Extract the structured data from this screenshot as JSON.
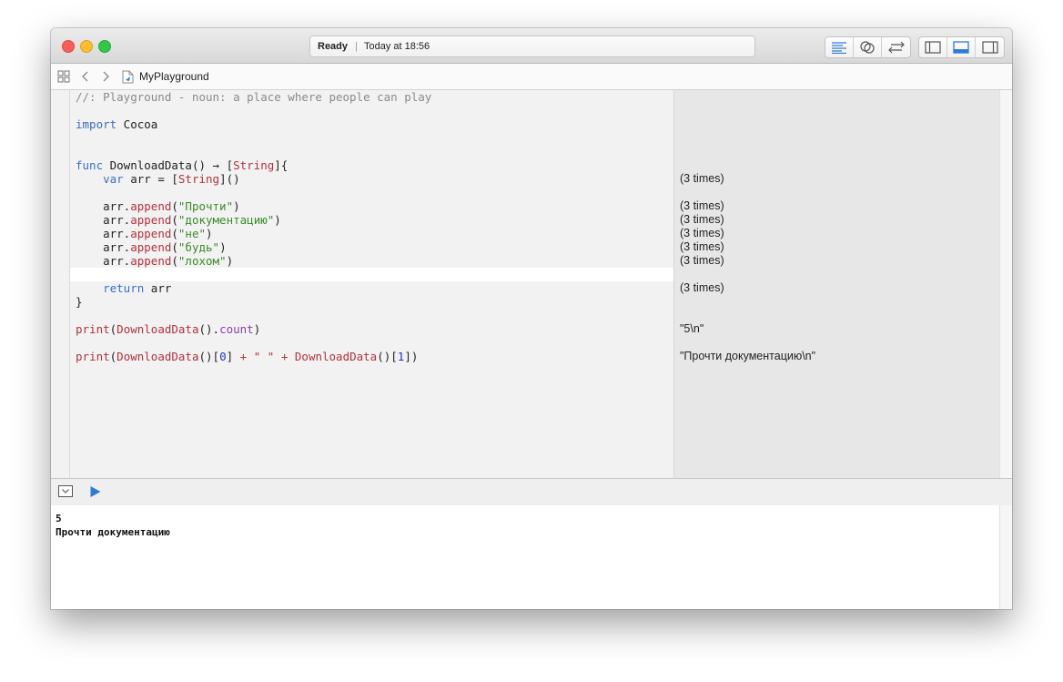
{
  "status": {
    "state": "Ready",
    "separator": "|",
    "time": "Today at 18:56"
  },
  "navbar": {
    "file_name": "MyPlayground"
  },
  "code_lines": [
    {
      "tokens": [
        {
          "t": "//: Playground - noun: a place where people can play",
          "c": "cm"
        }
      ]
    },
    {
      "tokens": [
        {
          "t": "import",
          "c": "kw"
        },
        {
          "t": " Cocoa",
          "c": ""
        }
      ]
    },
    {
      "tokens": [
        {
          "t": "func",
          "c": "kw"
        },
        {
          "t": " DownloadData() → [",
          "c": ""
        },
        {
          "t": "String",
          "c": "ty"
        },
        {
          "t": "]{",
          "c": ""
        }
      ]
    },
    {
      "tokens": [
        {
          "t": "    ",
          "c": ""
        },
        {
          "t": "var",
          "c": "kw"
        },
        {
          "t": " arr = [",
          "c": ""
        },
        {
          "t": "String",
          "c": "ty"
        },
        {
          "t": "]()",
          "c": ""
        }
      ]
    },
    {
      "tokens": [
        {
          "t": "    arr.",
          "c": ""
        },
        {
          "t": "append",
          "c": "fn"
        },
        {
          "t": "(",
          "c": ""
        },
        {
          "t": "\"Прочти\"",
          "c": "str"
        },
        {
          "t": ")",
          "c": ""
        }
      ]
    },
    {
      "tokens": [
        {
          "t": "    arr.",
          "c": ""
        },
        {
          "t": "append",
          "c": "fn"
        },
        {
          "t": "(",
          "c": ""
        },
        {
          "t": "\"документацию\"",
          "c": "str"
        },
        {
          "t": ")",
          "c": ""
        }
      ]
    },
    {
      "tokens": [
        {
          "t": "    arr.",
          "c": ""
        },
        {
          "t": "append",
          "c": "fn"
        },
        {
          "t": "(",
          "c": ""
        },
        {
          "t": "\"не\"",
          "c": "str"
        },
        {
          "t": ")",
          "c": ""
        }
      ]
    },
    {
      "tokens": [
        {
          "t": "    arr.",
          "c": ""
        },
        {
          "t": "append",
          "c": "fn"
        },
        {
          "t": "(",
          "c": ""
        },
        {
          "t": "\"будь\"",
          "c": "str"
        },
        {
          "t": ")",
          "c": ""
        }
      ]
    },
    {
      "tokens": [
        {
          "t": "    arr.",
          "c": ""
        },
        {
          "t": "append",
          "c": "fn"
        },
        {
          "t": "(",
          "c": ""
        },
        {
          "t": "\"лохом\"",
          "c": "str"
        },
        {
          "t": ")",
          "c": ""
        }
      ]
    },
    {
      "tokens": [
        {
          "t": "    ",
          "c": ""
        },
        {
          "t": "return",
          "c": "kw"
        },
        {
          "t": " arr",
          "c": ""
        }
      ]
    },
    {
      "tokens": [
        {
          "t": "}",
          "c": ""
        }
      ]
    },
    {
      "tokens": [
        {
          "t": "print",
          "c": "fn"
        },
        {
          "t": "(",
          "c": ""
        },
        {
          "t": "DownloadData",
          "c": "fn"
        },
        {
          "t": "().",
          "c": ""
        },
        {
          "t": "count",
          "c": "mem"
        },
        {
          "t": ")",
          "c": ""
        }
      ]
    },
    {
      "tokens": [
        {
          "t": "print",
          "c": "fn"
        },
        {
          "t": "(",
          "c": ""
        },
        {
          "t": "DownloadData",
          "c": "fn"
        },
        {
          "t": "()[",
          "c": ""
        },
        {
          "t": "0",
          "c": "num"
        },
        {
          "t": "] ",
          "c": ""
        },
        {
          "t": "+",
          "c": "fn"
        },
        {
          "t": " ",
          "c": ""
        },
        {
          "t": "\" \"",
          "c": "fn"
        },
        {
          "t": " ",
          "c": ""
        },
        {
          "t": "+",
          "c": "fn"
        },
        {
          "t": " ",
          "c": ""
        },
        {
          "t": "DownloadData",
          "c": "fn"
        },
        {
          "t": "()[",
          "c": ""
        },
        {
          "t": "1",
          "c": "num"
        },
        {
          "t": "])",
          "c": ""
        }
      ]
    }
  ],
  "results": [
    "(3 times)",
    "(3 times)",
    "(3 times)",
    "(3 times)",
    "(3 times)",
    "(3 times)",
    "(3 times)",
    "\"5\\n\"",
    "\"Прочти документацию\\n\""
  ],
  "console_lines": [
    "5",
    "Прочти документацию"
  ]
}
